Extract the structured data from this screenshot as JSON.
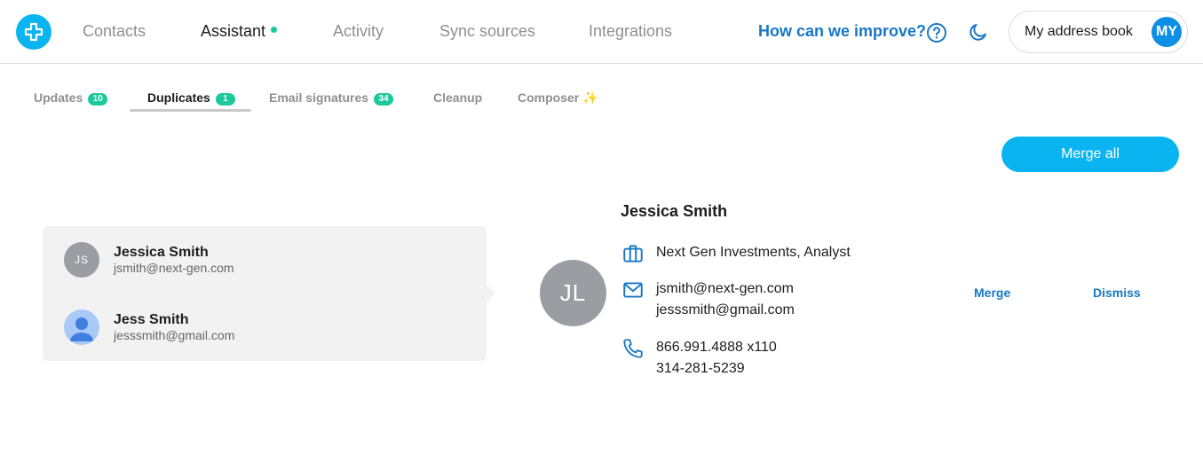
{
  "nav": {
    "items": [
      {
        "label": "Contacts"
      },
      {
        "label": "Assistant"
      },
      {
        "label": "Activity"
      },
      {
        "label": "Sync sources"
      },
      {
        "label": "Integrations"
      }
    ],
    "improve_label": "How can we improve?",
    "address_book_label": "My address book",
    "avatar_initials": "MY"
  },
  "subtabs": [
    {
      "label": "Updates",
      "count": "10"
    },
    {
      "label": "Duplicates",
      "count": "1"
    },
    {
      "label": "Email signatures",
      "count": "34"
    },
    {
      "label": "Cleanup"
    },
    {
      "label": "Composer",
      "icon": "sparkles-icon"
    }
  ],
  "merge_all_label": "Merge all",
  "duplicates": [
    {
      "name": "Jessica Smith",
      "email": "jsmith@next-gen.com",
      "initials": "JS"
    },
    {
      "name": "Jess Smith",
      "email": "jesssmith@gmail.com",
      "avatar": "person-photo"
    }
  ],
  "preview": {
    "initials": "JL",
    "name": "Jessica Smith",
    "company": "Next Gen Investments, Analyst",
    "emails": [
      "jsmith@next-gen.com",
      "jesssmith@gmail.com"
    ],
    "phones": [
      "866.991.4888 x110",
      "314-281-5239"
    ]
  },
  "actions": {
    "merge_label": "Merge",
    "dismiss_label": "Dismiss"
  },
  "colors": {
    "accent": "#0ab4f0",
    "link": "#1778c6",
    "badge": "#1cc99a"
  }
}
